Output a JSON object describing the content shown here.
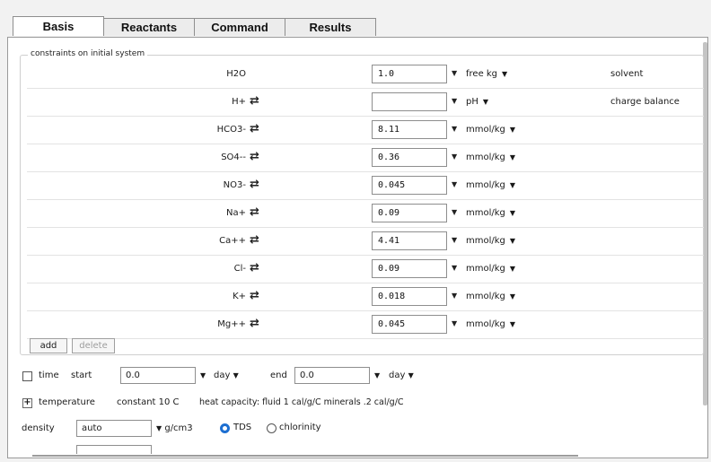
{
  "tabs": [
    {
      "label": "Basis",
      "active": true
    },
    {
      "label": "Reactants",
      "active": false
    },
    {
      "label": "Command",
      "active": false
    },
    {
      "label": "Results",
      "active": false
    }
  ],
  "group": {
    "legend": "constraints on initial system"
  },
  "rows": [
    {
      "species": "H2O",
      "value": "1.0",
      "unit": "free kg",
      "note": "solvent",
      "swap": false
    },
    {
      "species": "H+",
      "value": "",
      "unit": "pH",
      "note": "charge balance",
      "swap": true
    },
    {
      "species": "HCO3-",
      "value": "8.11",
      "unit": "mmol/kg",
      "note": "",
      "swap": true
    },
    {
      "species": "SO4--",
      "value": "0.36",
      "unit": "mmol/kg",
      "note": "",
      "swap": true
    },
    {
      "species": "NO3-",
      "value": "0.045",
      "unit": "mmol/kg",
      "note": "",
      "swap": true
    },
    {
      "species": "Na+",
      "value": "0.09",
      "unit": "mmol/kg",
      "note": "",
      "swap": true
    },
    {
      "species": "Ca++",
      "value": "4.41",
      "unit": "mmol/kg",
      "note": "",
      "swap": true
    },
    {
      "species": "Cl-",
      "value": "0.09",
      "unit": "mmol/kg",
      "note": "",
      "swap": true
    },
    {
      "species": "K+",
      "value": "0.018",
      "unit": "mmol/kg",
      "note": "",
      "swap": true
    },
    {
      "species": "Mg++",
      "value": "0.045",
      "unit": "mmol/kg",
      "note": "",
      "swap": true
    }
  ],
  "buttons": {
    "add": "add",
    "delete": "delete"
  },
  "time": {
    "label": "time",
    "start_label": "start",
    "start_value": "0.0",
    "start_unit": "day",
    "end_label": "end",
    "end_value": "0.0",
    "end_unit": "day"
  },
  "temperature": {
    "label": "temperature",
    "value": "constant 10 C",
    "heat_capacity": "heat capacity:  fluid 1 cal/g/C   minerals .2 cal/g/C"
  },
  "density": {
    "label": "density",
    "value": "auto",
    "unit": "g/cm3",
    "tds_label": "TDS",
    "chlorinity_label": "chlorinity"
  },
  "icons": {
    "swap": "⇄",
    "caret": "▼",
    "plus": "+"
  }
}
